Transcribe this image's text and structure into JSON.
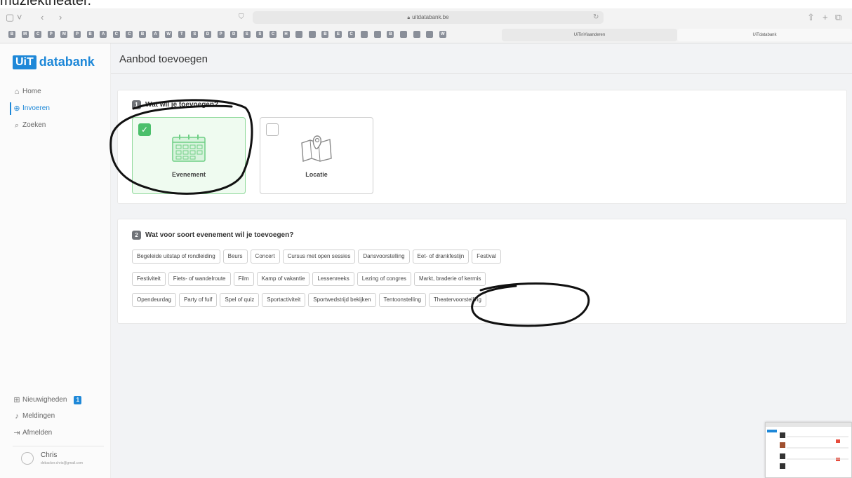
{
  "caption": "muziektheater.",
  "browser": {
    "address": "uitdatabank.be",
    "tabs": [
      "UiTinVlaanderen",
      "UiTdatabank"
    ],
    "bookmark_letters": [
      "B",
      "M",
      "C",
      "P",
      "M",
      "P",
      "B",
      "A",
      "C",
      "C",
      "B",
      "A",
      "W",
      "T",
      "S",
      "D",
      "P",
      "D",
      "S",
      "S",
      "C",
      "H",
      "",
      "",
      "B",
      "E",
      "C",
      "",
      "",
      "B",
      "",
      "",
      "",
      "W"
    ]
  },
  "sidebar": {
    "logo_box": "UiT",
    "logo_text": "databank",
    "nav": [
      {
        "label": "Home",
        "icon": "home-icon"
      },
      {
        "label": "Invoeren",
        "icon": "plus-circle-icon",
        "active": true
      },
      {
        "label": "Zoeken",
        "icon": "search-icon"
      }
    ],
    "bottom": [
      {
        "label": "Nieuwigheden",
        "icon": "gift-icon",
        "badge": "1"
      },
      {
        "label": "Meldingen",
        "icon": "bell-icon"
      },
      {
        "label": "Afmelden",
        "icon": "logout-icon"
      }
    ],
    "user": {
      "name": "Chris",
      "email": "debacker.chris@gmail.com"
    }
  },
  "main": {
    "title": "Aanbod toevoegen",
    "step1": {
      "number": "1",
      "title": "Wat wil je toevoegen?",
      "options": [
        {
          "label": "Evenement",
          "selected": true,
          "icon": "calendar-icon"
        },
        {
          "label": "Locatie",
          "selected": false,
          "icon": "map-icon"
        }
      ]
    },
    "step2": {
      "number": "2",
      "title": "Wat voor soort evenement wil je toevoegen?",
      "rows": [
        [
          "Begeleide uitstap of rondleiding",
          "Beurs",
          "Concert",
          "Cursus met open sessies",
          "Dansvoorstelling",
          "Eet- of drankfestijn",
          "Festival"
        ],
        [
          "Festiviteit",
          "Fiets- of wandelroute",
          "Film",
          "Kamp of vakantie",
          "Lessenreeks",
          "Lezing of congres",
          "Markt, braderie of kermis"
        ],
        [
          "Opendeurdag",
          "Party of fuif",
          "Spel of quiz",
          "Sportactiviteit",
          "Sportwedstrijd bekijken",
          "Tentoonstelling",
          "Theatervoorstelling"
        ]
      ]
    }
  },
  "colors": {
    "accent": "#1e88d8",
    "selected_bg": "#effbf0",
    "check": "#4bbf6b"
  }
}
